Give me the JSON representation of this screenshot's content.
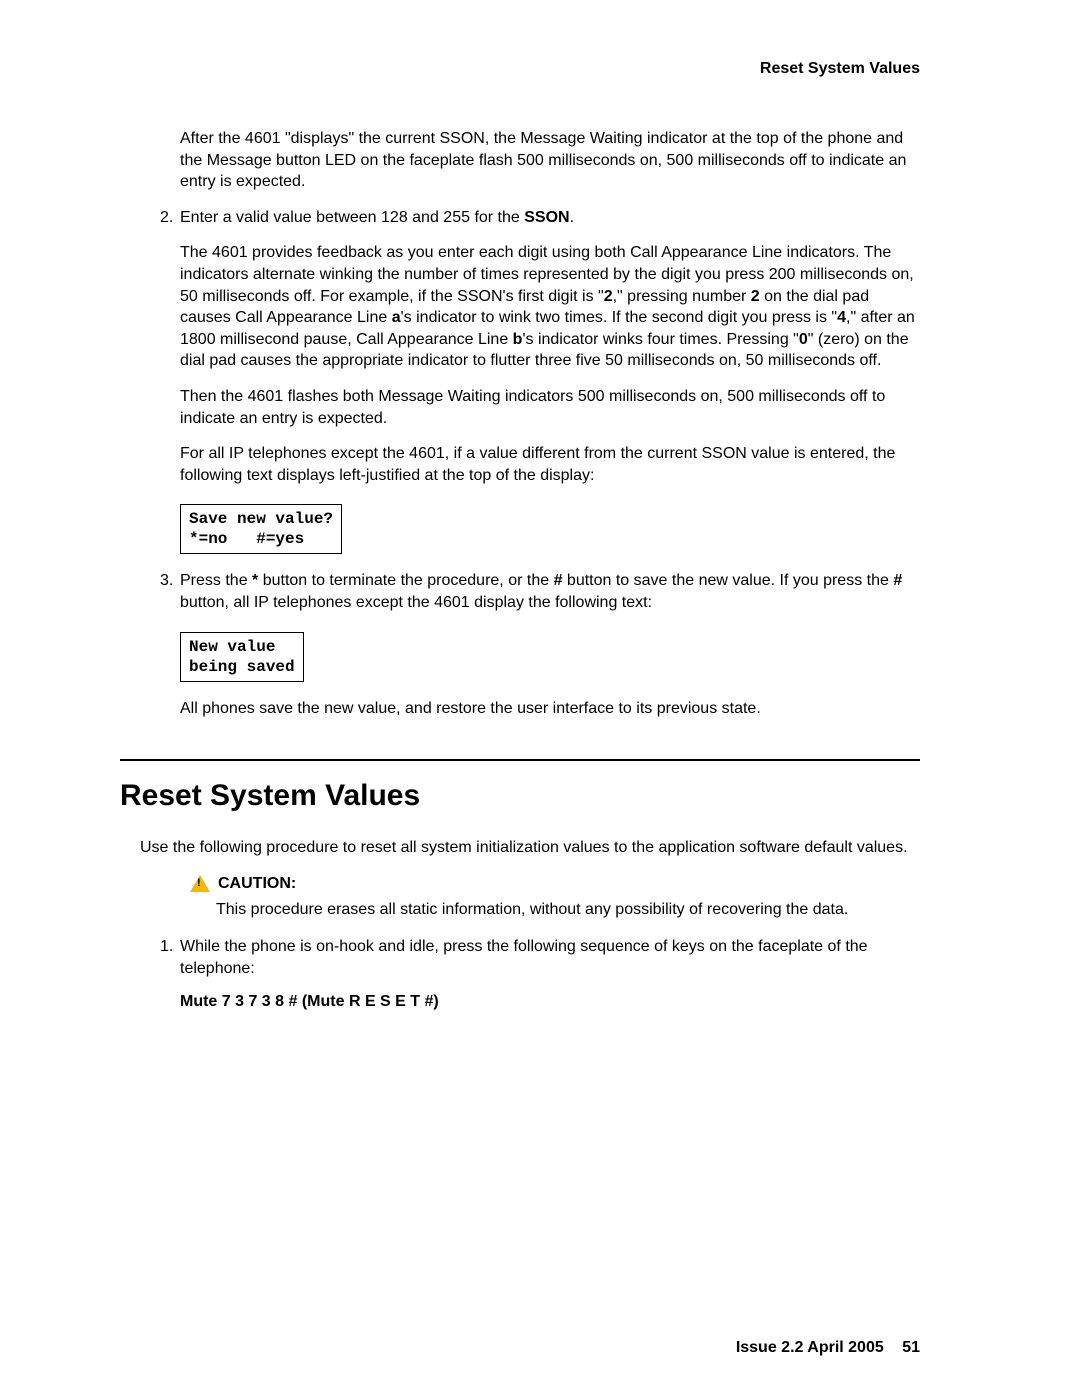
{
  "header": {
    "title": "Reset System Values"
  },
  "p_after4601": "After the 4601 \"displays\" the current SSON, the Message Waiting indicator at the top of the phone and the Message button LED on the faceplate flash 500 milliseconds on, 500 milliseconds off to indicate an entry is expected.",
  "step2": {
    "num": "2.",
    "pre": "Enter a valid value between 128 and 255 for the ",
    "bold": "SSON",
    "post": "."
  },
  "feedback": {
    "t1": "The 4601 provides feedback as you enter each digit using both Call Appearance Line indicators. The indicators alternate winking the number of times represented by the digit you press 200 milliseconds on, 50 milliseconds off. For example, if the SSON's first digit is \"",
    "d1": "2",
    "t2": ",\" pressing number ",
    "d2": "2",
    "t3": " on the dial pad causes Call Appearance Line ",
    "a": "a",
    "t4": "'s indicator to wink two times. If the second digit you press is \"",
    "d3": "4",
    "t5": ",\" after an 1800 millisecond pause, Call Appearance Line ",
    "b": "b",
    "t6": "'s indicator winks four times. Pressing \"",
    "d4": "0",
    "t7": "\" (zero) on the dial pad causes the appropriate indicator to flutter three five 50 milliseconds on, 50 milliseconds off."
  },
  "then4601": "Then the 4601 flashes both Message Waiting indicators 500 milliseconds on, 500 milliseconds off to indicate an entry is expected.",
  "forall": "For all IP telephones except the 4601, if a value different from the current SSON value is entered, the following text displays left-justified at the top of the display:",
  "box1": "Save new value?\n*=no   #=yes",
  "step3": {
    "num": "3.",
    "t1": "Press the ",
    "star": "*",
    "t2": " button to terminate the procedure, or the ",
    "hash": "#",
    "t3": " button to save the new value. If you press the ",
    "hash2": "#",
    "t4": " button, all IP telephones except the 4601 display the following text:"
  },
  "box2": "New value\nbeing saved",
  "allphones": "All phones save the new value, and restore the user interface to its previous state.",
  "section_title": "Reset System Values",
  "reset_intro": "Use the following procedure to reset all system initialization values to the application software default values.",
  "caution_label": "CAUTION:",
  "caution_body": "This procedure erases all static information, without any possibility of recovering the data.",
  "resetstep1": {
    "num": "1.",
    "text": "While the phone is on-hook and idle, press the following sequence of keys on the faceplate of the telephone:"
  },
  "keyseq": "Mute 7 3 7 3 8 # (Mute R E S E T #)",
  "footer": {
    "issue": "Issue 2.2   April 2005",
    "page": "51"
  }
}
